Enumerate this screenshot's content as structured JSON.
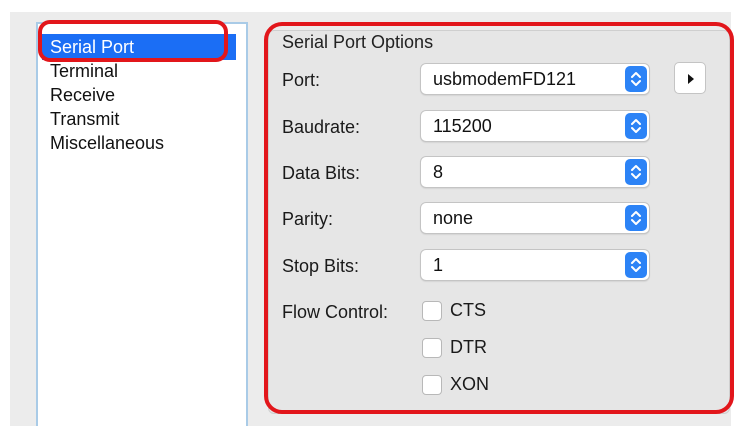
{
  "sidebar": {
    "items": [
      {
        "label": "Serial Port",
        "selected": true
      },
      {
        "label": "Terminal",
        "selected": false
      },
      {
        "label": "Receive",
        "selected": false
      },
      {
        "label": "Transmit",
        "selected": false
      },
      {
        "label": "Miscellaneous",
        "selected": false
      }
    ]
  },
  "options": {
    "title": "Serial Port Options",
    "port": {
      "label": "Port:",
      "value": "usbmodemFD121"
    },
    "baudrate": {
      "label": "Baudrate:",
      "value": "115200"
    },
    "data_bits": {
      "label": "Data Bits:",
      "value": "8"
    },
    "parity": {
      "label": "Parity:",
      "value": "none"
    },
    "stop_bits": {
      "label": "Stop Bits:",
      "value": "1"
    },
    "flow_control": {
      "label": "Flow Control:",
      "options": [
        {
          "label": "CTS",
          "checked": false
        },
        {
          "label": "DTR",
          "checked": false
        },
        {
          "label": "XON",
          "checked": false
        }
      ]
    }
  },
  "colors": {
    "highlight": "#e2161b",
    "selection": "#1b6ef5",
    "stepper": "#2c83f6"
  },
  "icons": {
    "stepper": "up-down-chevron-icon",
    "side_button": "play-triangle-icon"
  }
}
